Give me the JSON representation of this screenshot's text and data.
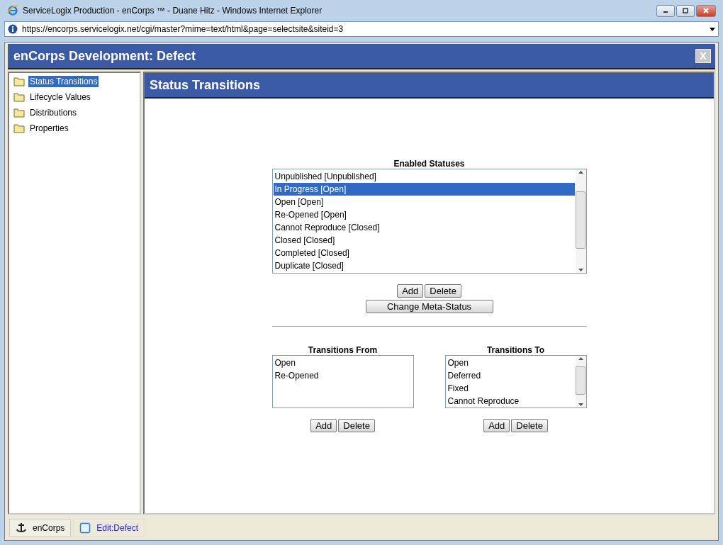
{
  "window": {
    "title": "ServiceLogix Production - enCorps ™ - Duane Hitz - Windows Internet Explorer"
  },
  "address_bar": {
    "url": "https://encorps.servicelogix.net/cgi/master?mime=text/html&page=selectsite&siteid=3"
  },
  "dialog": {
    "title": "enCorps Development: Defect",
    "close": "X"
  },
  "sidebar": {
    "items": [
      {
        "label": "Status Transitions",
        "selected": true
      },
      {
        "label": "Lifecycle Values",
        "selected": false
      },
      {
        "label": "Distributions",
        "selected": false
      },
      {
        "label": "Properties",
        "selected": false
      }
    ]
  },
  "panel": {
    "title": "Status Transitions"
  },
  "enabled_statuses": {
    "label": "Enabled Statuses",
    "items": [
      {
        "label": "Unpublished [Unpublished]",
        "selected": false
      },
      {
        "label": "In Progress [Open]",
        "selected": true
      },
      {
        "label": "Open [Open]",
        "selected": false
      },
      {
        "label": "Re-Opened [Open]",
        "selected": false
      },
      {
        "label": "Cannot Reproduce [Closed]",
        "selected": false
      },
      {
        "label": "Closed [Closed]",
        "selected": false
      },
      {
        "label": "Completed [Closed]",
        "selected": false
      },
      {
        "label": "Duplicate [Closed]",
        "selected": false
      }
    ],
    "buttons": [
      "Add",
      "Delete"
    ],
    "meta_button": "Change Meta-Status"
  },
  "transitions_from": {
    "label": "Transitions From",
    "items": [
      {
        "label": "Open",
        "selected": false
      },
      {
        "label": "Re-Opened",
        "selected": false
      }
    ],
    "buttons": [
      "Add",
      "Delete"
    ]
  },
  "transitions_to": {
    "label": "Transitions To",
    "items": [
      {
        "label": "Open",
        "selected": false
      },
      {
        "label": "Deferred",
        "selected": false
      },
      {
        "label": "Fixed",
        "selected": false
      },
      {
        "label": "Cannot Reproduce",
        "selected": false
      }
    ],
    "buttons": [
      "Add",
      "Delete"
    ]
  },
  "taskbar": {
    "items": [
      {
        "label": "enCorps",
        "kind": "anchor",
        "selected": false
      },
      {
        "label": "Edit:Defect",
        "kind": "window",
        "selected": true
      }
    ]
  }
}
